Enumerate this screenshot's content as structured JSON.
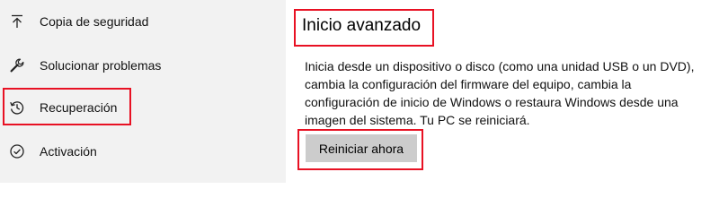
{
  "sidebar": {
    "items": [
      {
        "label": "Copia de seguridad",
        "icon": "backup-arrow-up-icon"
      },
      {
        "label": "Solucionar problemas",
        "icon": "wrench-icon"
      },
      {
        "label": "Recuperación",
        "icon": "history-icon"
      },
      {
        "label": "Activación",
        "icon": "check-circle-icon"
      }
    ]
  },
  "main": {
    "title": "Inicio avanzado",
    "description": "Inicia desde un dispositivo o disco (como una unidad USB o un DVD), cambia la configuración del firmware del equipo, cambia la configuración de inicio de Windows o restaura Windows desde una imagen del sistema. Tu PC se reiniciará.",
    "restart_button": "Reiniciar ahora"
  },
  "colors": {
    "sidebar_background": "#f2f2f2",
    "button_background": "#cccccc",
    "highlight_border": "#e81123"
  }
}
